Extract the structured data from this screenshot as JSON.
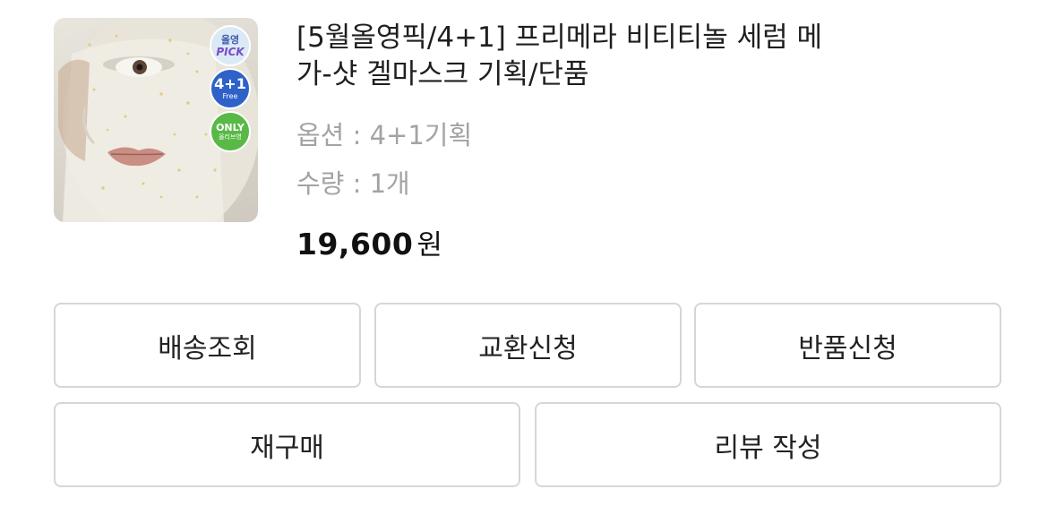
{
  "product": {
    "title_line1": "[5월올영픽/4+1] 프리메라 비티티놀 세럼 메",
    "title_line2": "가-샷 겔마스크 기획/단품",
    "option": "옵션 : 4+1기획",
    "quantity": "수량 : 1개",
    "price_amount": "19,600",
    "price_unit": "원",
    "image_icon": "face-mask-photo",
    "badges": {
      "pick_line1": "올영",
      "pick_line2": "PICK",
      "promo_line1": "4+1",
      "promo_line2": "Free",
      "only_line1": "ONLY",
      "only_line2": "올리브영"
    }
  },
  "actions": {
    "track_label": "배송조회",
    "exchange_label": "교환신청",
    "return_label": "반품신청",
    "reorder_label": "재구매",
    "review_label": "리뷰 작성"
  },
  "colors": {
    "border": "#d6d6d6",
    "meta_text": "#a3a3a3",
    "promo_badge": "#2f62c8",
    "only_badge": "#58b947"
  }
}
